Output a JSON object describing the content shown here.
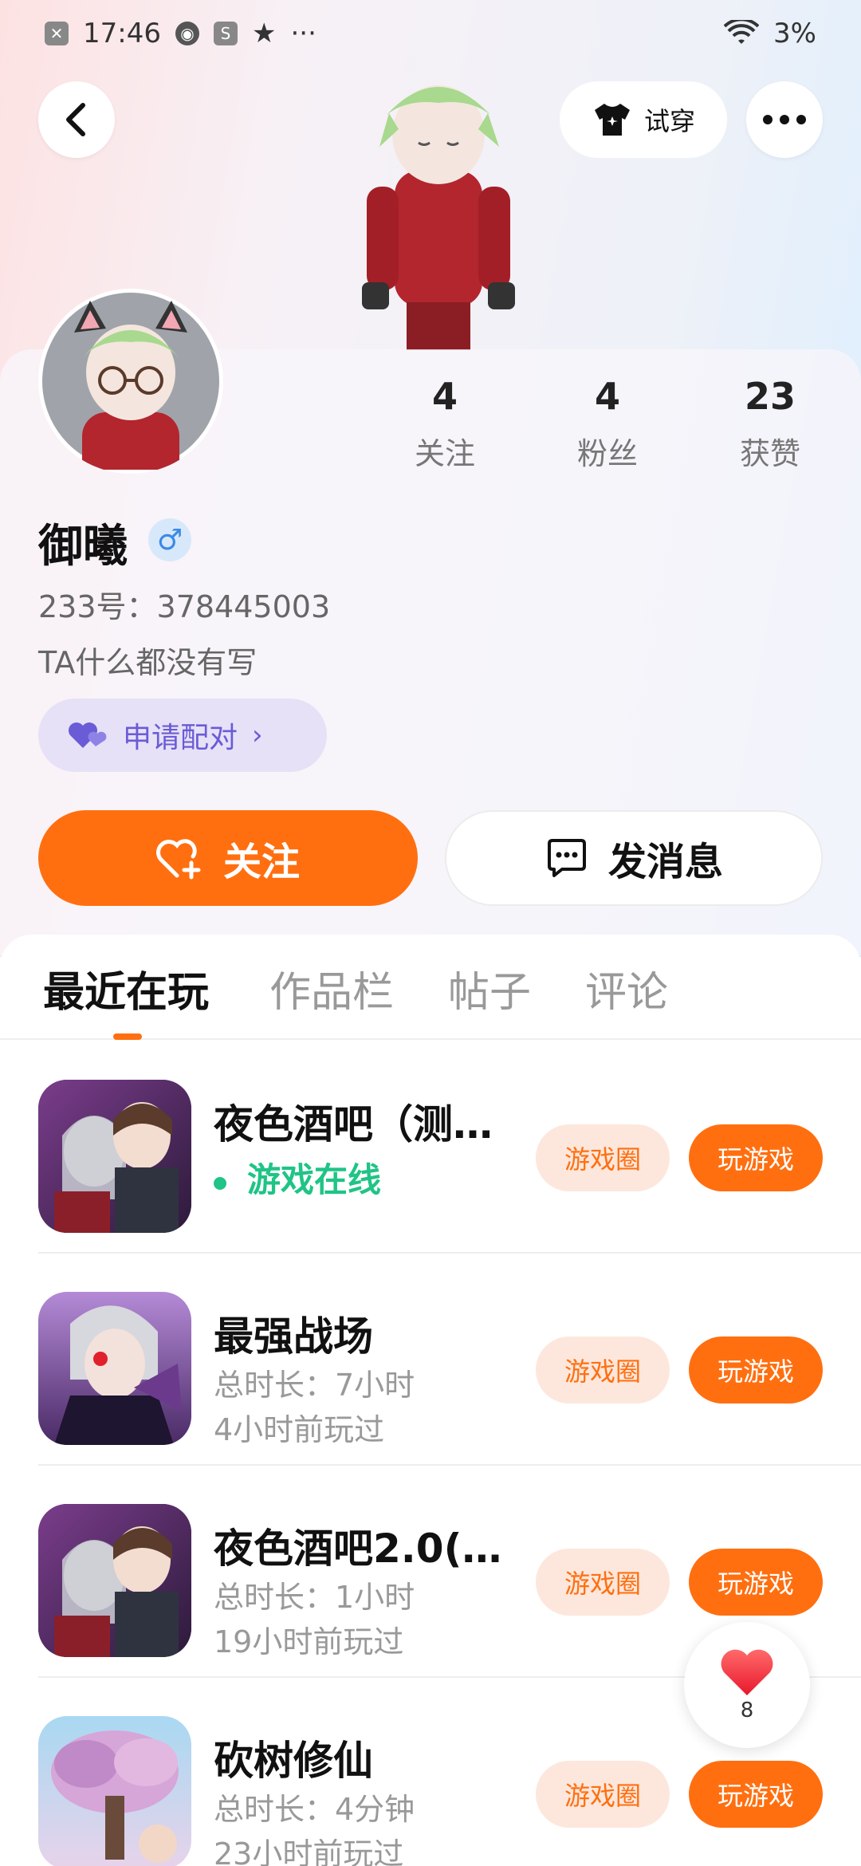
{
  "status_bar": {
    "time": "17:46",
    "battery": "3%"
  },
  "header": {
    "try_on_label": "试穿"
  },
  "profile": {
    "username": "御曦",
    "gender_symbol": "♂",
    "uid_line": "233号：378445003",
    "bio": "TA什么都没有写",
    "pair_label": "申请配对",
    "stats": [
      {
        "value": "4",
        "label": "关注"
      },
      {
        "value": "4",
        "label": "粉丝"
      },
      {
        "value": "23",
        "label": "获赞"
      }
    ]
  },
  "actions": {
    "follow_label": "关注",
    "message_label": "发消息"
  },
  "tabs": [
    {
      "label": "最近在玩",
      "active": true
    },
    {
      "label": "作品栏",
      "active": false
    },
    {
      "label": "帖子",
      "active": false
    },
    {
      "label": "评论",
      "active": false
    }
  ],
  "games": [
    {
      "title": "夜色酒吧（测…",
      "line1": "游戏在线",
      "line2": "",
      "online": true,
      "circle_label": "游戏圈",
      "play_label": "玩游戏"
    },
    {
      "title": "最强战场",
      "line1": "总时长：7小时",
      "line2": "4小时前玩过",
      "online": false,
      "circle_label": "游戏圈",
      "play_label": "玩游戏"
    },
    {
      "title": "夜色酒吧2.0(…",
      "line1": "总时长：1小时",
      "line2": "19小时前玩过",
      "online": false,
      "circle_label": "游戏圈",
      "play_label": "玩游戏"
    },
    {
      "title": "砍树修仙",
      "line1": "总时长：4分钟",
      "line2": "23小时前玩过",
      "online": false,
      "circle_label": "游戏圈",
      "play_label": "玩游戏"
    }
  ],
  "like_fab": {
    "count": "8"
  },
  "colors": {
    "accent": "#ff6f10",
    "online": "#1fc486",
    "pair": "#6a5bd6"
  }
}
